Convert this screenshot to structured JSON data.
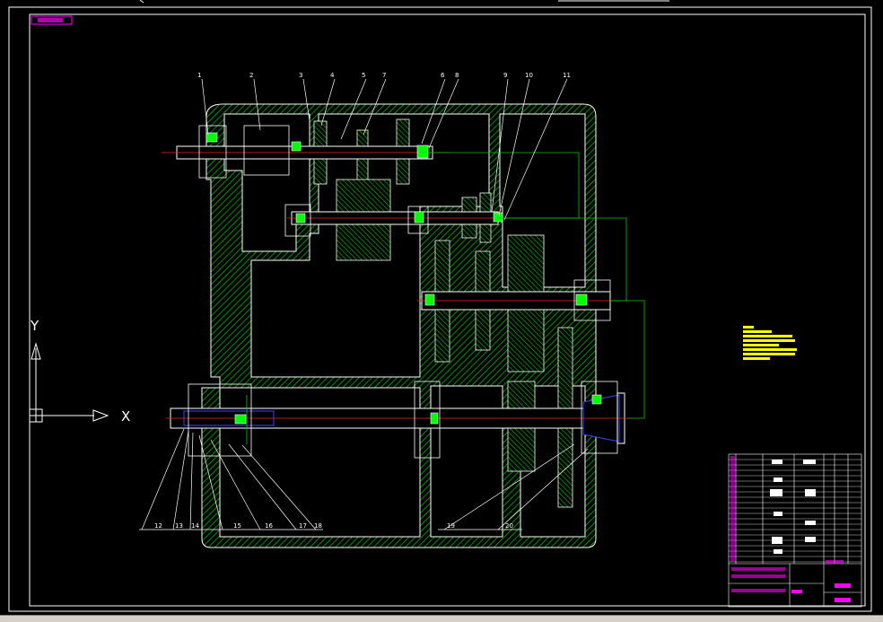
{
  "ucs": {
    "x_label": "X",
    "y_label": "Y"
  },
  "part_numbers": [
    "1",
    "2",
    "3",
    "4",
    "5",
    "7",
    "6",
    "8",
    "9",
    "10",
    "11",
    "12",
    "13",
    "14",
    "15",
    "16",
    "17",
    "18",
    "19",
    "20"
  ],
  "colors": {
    "background": "#000000",
    "frame": "#ffffff",
    "housing_hatch": "#00c800",
    "shaft": "#ffffff",
    "center_line": "#ff2020",
    "dimension": "#00c800",
    "bearing": "#00ff00",
    "title_tag": "#ff00ff",
    "notes": "#ffff00",
    "shaft_blue": "#4040ff"
  }
}
